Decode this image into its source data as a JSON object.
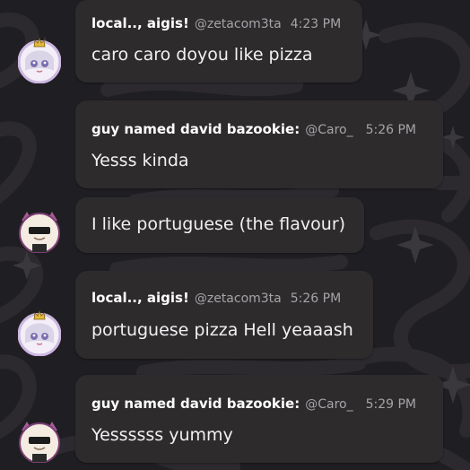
{
  "messages": [
    {
      "username": "local.., aigis!",
      "handle": "@zetacom3ta",
      "time": "4:23 PM",
      "text": "caro caro doyou like pizza",
      "avatar": "anime-girl-avatar"
    },
    {
      "username": "guy named david bazookie:",
      "handle": "@Caro_",
      "time": "5:26 PM",
      "text": "Yesss kinda",
      "avatar": null
    },
    {
      "username": null,
      "handle": null,
      "time": null,
      "text": "I like portuguese (the flavour)",
      "avatar": "cat-sunglasses-avatar"
    },
    {
      "username": "local.., aigis!",
      "handle": "@zetacom3ta",
      "time": "5:26 PM",
      "text": "portuguese pizza Hell yeaaash",
      "avatar": "anime-girl-avatar"
    },
    {
      "username": "guy named david bazookie:",
      "handle": "@Caro_",
      "time": "5:29 PM",
      "text": "Yessssss yummy",
      "avatar": "cat-sunglasses-avatar"
    }
  ],
  "colors": {
    "background": "#1f1e22",
    "bubble": "#2d2b2c",
    "text": "#f2f0f2",
    "muted": "#a6a4a8",
    "avatar_ring": "#cbb7e0"
  }
}
